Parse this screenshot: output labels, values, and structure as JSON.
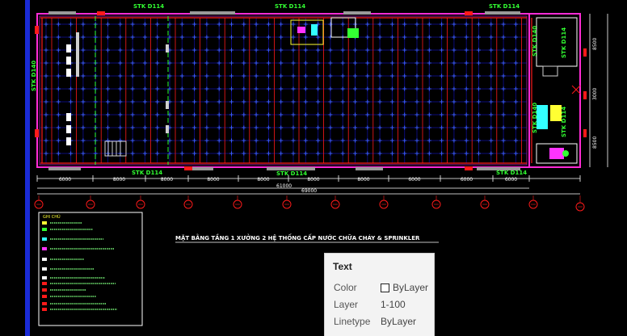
{
  "drawing": {
    "pipe_labels": {
      "top1": "STK D114",
      "top2": "STK D114",
      "top3": "STK D114",
      "bottom1": "STK D114",
      "bottom2": "STK D114",
      "bottom3": "STK D114",
      "left_vertical": "STK D140",
      "right_v1": "STK D140",
      "right_v2": "STK D114",
      "right_v3": "STK D140",
      "right_v4": "STK D114"
    },
    "bay_dimensions": [
      "6000",
      "8000",
      "8000",
      "8000",
      "8000",
      "8000",
      "8000",
      "6000",
      "6000",
      "6000"
    ],
    "overall_dim_1": "61000",
    "overall_dim_2": "69000",
    "right_dimensions": [
      "8500",
      "3000",
      "8500"
    ],
    "title": "MẶT BẰNG TẦNG 1 XƯỞNG 2 HỆ THỐNG CẤP NƯỚC CHỮA CHÁY & SPRINKLER",
    "legend_heading": "GHI CHÚ"
  },
  "properties_panel": {
    "title": "Text",
    "rows": [
      {
        "label": "Color",
        "value": "ByLayer",
        "swatch": "#ffffff"
      },
      {
        "label": "Layer",
        "value": "1-100"
      },
      {
        "label": "Linetype",
        "value": "ByLayer"
      }
    ]
  },
  "colors": {
    "background": "#000000",
    "wall": "#ff2bd6",
    "pipe": "#ff1a1a",
    "sprinkler": "#3a5bff",
    "grid": "#0b0b7a",
    "label_green": "#32ff32",
    "dimension": "#ffffff"
  }
}
